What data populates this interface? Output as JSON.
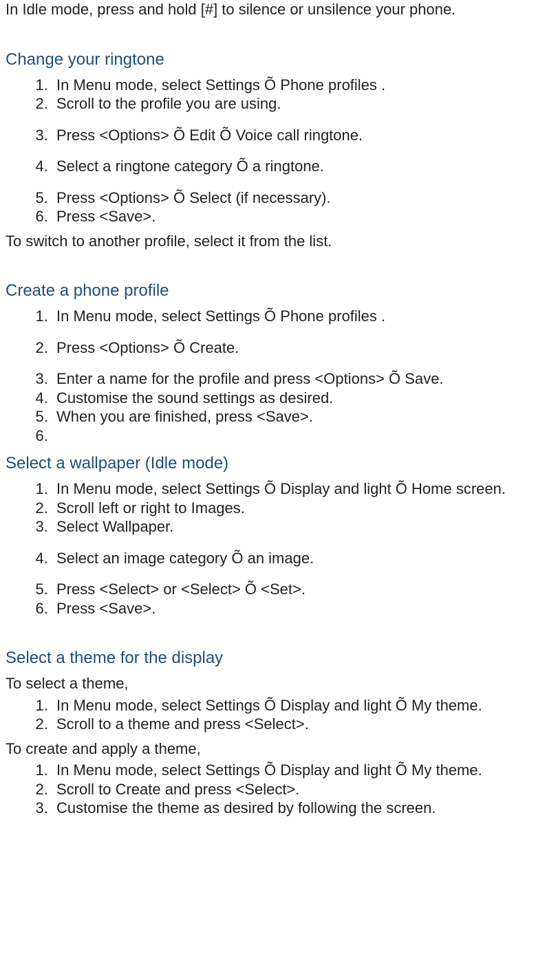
{
  "intro": "In Idle mode, press and hold [#] to silence or unsilence your phone.",
  "sections": {
    "change_ringtone": {
      "heading": "Change your ringtone",
      "items": [
        "In Menu mode, select Settings Õ Phone profiles .",
        "Scroll to the profile you are using.",
        "Press <Options> Õ Edit Õ Voice call ringtone.",
        "Select a ringtone category Õ a ringtone.",
        "Press <Options> Õ Select (if necessary).",
        "Press <Save>."
      ],
      "trailer": "To switch to another profile, select it from the list."
    },
    "create_profile": {
      "heading": "Create a phone profile",
      "items": [
        "In Menu mode, select Settings Õ Phone profiles .",
        "Press <Options> Õ Create.",
        "Enter a name for the profile and press <Options> Õ Save.",
        "Customise the sound settings as desired.",
        "When you are finished, press <Save>.",
        ""
      ]
    },
    "select_wallpaper": {
      "heading": "Select a wallpaper (Idle mode)",
      "items": [
        "In Menu mode, select Settings Õ Display and light Õ Home screen.",
        "Scroll left or right to Images.",
        "Select Wallpaper.",
        "Select an image category Õ an image.",
        "Press <Select> or <Select> Õ <Set>.",
        "Press <Save>."
      ]
    },
    "select_theme": {
      "heading": "Select a theme for the display",
      "sub1": "To select a theme,",
      "items1": [
        "In Menu mode, select Settings Õ Display and light Õ My theme.",
        "Scroll to a theme and press <Select>."
      ],
      "sub2": "To create and apply a theme,",
      "items2": [
        "In Menu mode, select Settings Õ Display and light Õ My theme.",
        "Scroll to Create and press <Select>.",
        "Customise the theme as desired by following the screen."
      ]
    }
  }
}
